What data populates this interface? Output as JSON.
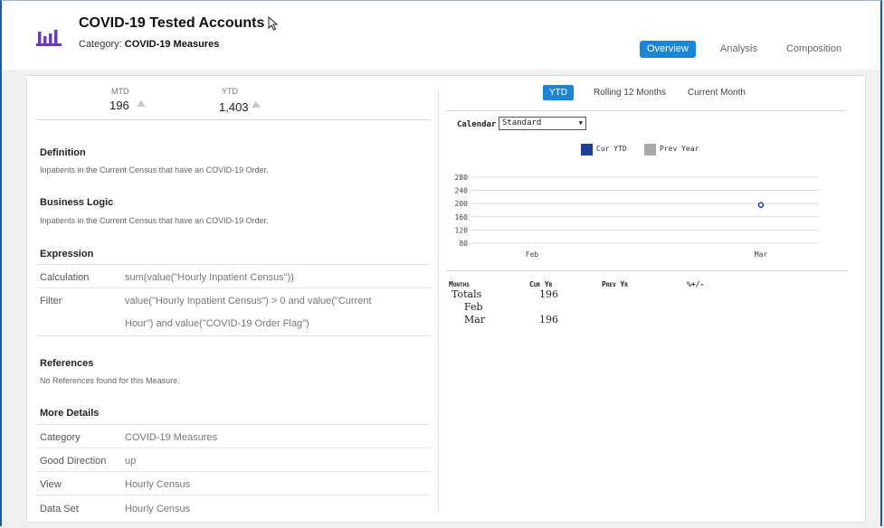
{
  "header": {
    "title": "COVID-19 Tested Accounts",
    "category_label": "Category:",
    "category_value": "COVID-19 Measures",
    "nav": [
      "Overview",
      "Analysis",
      "Composition"
    ]
  },
  "summary": {
    "mtd_label": "MTD",
    "mtd_value": "196",
    "ytd_label": "YTD",
    "ytd_value": "1,403"
  },
  "definition": {
    "heading": "Definition",
    "text": "Inpatients in the Current Census that have an COVID-19 Order."
  },
  "business_logic": {
    "heading": "Business Logic",
    "text": "Inpatients in the Current Census that have an COVID-19 Order."
  },
  "expression": {
    "heading": "Expression",
    "calc_label": "Calculation",
    "calc_value": "sum(value(\"Hourly Inpatient Census\"))",
    "filter_label": "Filter",
    "filter_line1": "value(\"Hourly Inpatient Census\") > 0 and value(\"Current",
    "filter_line2": "Hour\") and value(\"COVID-19 Order Flag\")"
  },
  "references": {
    "heading": "References",
    "text": "No References found for this Measure."
  },
  "details": {
    "heading": "More Details",
    "rows": [
      {
        "label": "Category",
        "value": "COVID-19 Measures"
      },
      {
        "label": "Good Direction",
        "value": "up"
      },
      {
        "label": "View",
        "value": "Hourly Census"
      },
      {
        "label": "Data Set",
        "value": "Hourly Census"
      }
    ]
  },
  "tabs": [
    "YTD",
    "Rolling 12 Months",
    "Current Month"
  ],
  "calendar": {
    "label": "Calendar",
    "selected": "Standard"
  },
  "colors": {
    "accent": "#1a86d8",
    "cur_ytd": "#1f3f99",
    "prev_year": "#a8a8a8"
  },
  "chart_data": {
    "type": "line",
    "categories": [
      "Feb",
      "Mar"
    ],
    "series": [
      {
        "name": "Cur YTD",
        "values": [
          null,
          196
        ]
      },
      {
        "name": "Prev Year",
        "values": [
          null,
          null
        ]
      }
    ],
    "yticks": [
      80,
      120,
      160,
      200,
      240,
      280
    ],
    "ylim": [
      80,
      280
    ],
    "legend": "top",
    "grid": true
  },
  "table": {
    "headers": [
      "Months",
      "Cur Yr",
      "Prev Yr",
      "%+/-"
    ],
    "rows": [
      {
        "label": "Totals",
        "cur": "196"
      },
      {
        "label": "Feb",
        "cur": ""
      },
      {
        "label": "Mar",
        "cur": "196"
      }
    ]
  }
}
